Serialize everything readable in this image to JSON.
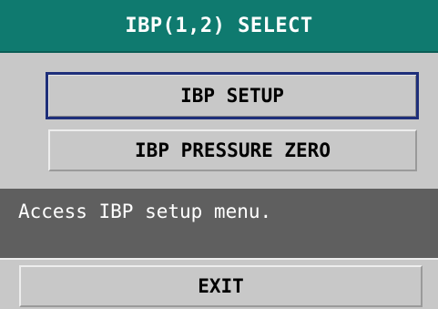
{
  "dialog": {
    "title": "IBP(1,2) SELECT"
  },
  "menu": {
    "items": [
      {
        "label": "IBP SETUP",
        "selected": true
      },
      {
        "label": "IBP PRESSURE ZERO",
        "selected": false
      }
    ]
  },
  "help": {
    "text": "Access IBP setup menu."
  },
  "footer": {
    "exit_label": "EXIT"
  },
  "colors": {
    "titlebar": "#0f7a6f",
    "background": "#c8c8c8",
    "selection_border": "#1e2f7a",
    "help_background": "#5f5f5f"
  }
}
